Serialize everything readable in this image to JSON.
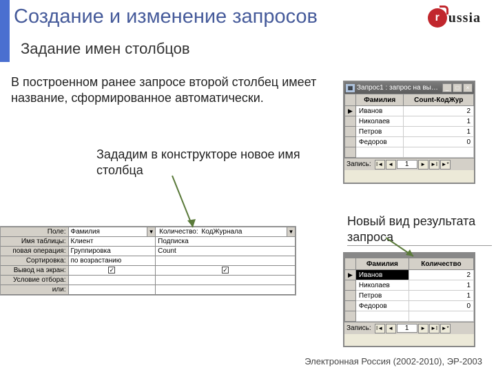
{
  "title": "Создание и изменение запросов",
  "subtitle": "Задание имен столбцов",
  "para1": "В построенном ранее запросе второй столбец имеет название, сформированное автоматически.",
  "para2": "Зададим в конструкторе новое имя столбца",
  "para3": "Новый вид результата запроса",
  "logo_text": "ussia",
  "logo_dot": "r",
  "footer": "Электронная Россия (2002-2010), ЭР-2003",
  "win1": {
    "title": "Запрос1 : запрос на вы…",
    "cols": [
      "Фамилия",
      "Count-КодЖур"
    ],
    "rows": [
      {
        "marker": "▶",
        "c0": "Иванов",
        "c1": "2"
      },
      {
        "marker": "",
        "c0": "Николаев",
        "c1": "1"
      },
      {
        "marker": "",
        "c0": "Петров",
        "c1": "1"
      },
      {
        "marker": "",
        "c0": "Федоров",
        "c1": "0"
      }
    ],
    "rec_label": "Запись:",
    "rec_pos": "1"
  },
  "win2": {
    "cols": [
      "Фамилия",
      "Количество"
    ],
    "rows": [
      {
        "marker": "▶",
        "c0": "Иванов",
        "c1": "2",
        "sel": true
      },
      {
        "marker": "",
        "c0": "Николаев",
        "c1": "1"
      },
      {
        "marker": "",
        "c0": "Петров",
        "c1": "1"
      },
      {
        "marker": "",
        "c0": "Федоров",
        "c1": "0"
      }
    ],
    "rec_label": "Запись:",
    "rec_pos": "1"
  },
  "qbe": {
    "labels": {
      "field": "Поле:",
      "table": "Имя таблицы:",
      "total": "повая операция:",
      "sort": "Сортировка:",
      "show": "Вывод на экран:",
      "criteria": "Условие отбора:",
      "or": "или:"
    },
    "col1": {
      "field": "Фамилия",
      "table": "Клиент",
      "total": "Группировка",
      "sort": "по возрастанию",
      "show": "✓"
    },
    "col2": {
      "field_label": "Количество:",
      "field_value": "КодЖурнала",
      "table": "Подписка",
      "total": "Count",
      "sort": "",
      "show": "✓"
    }
  },
  "navbtns": {
    "first": "I◄",
    "prev": "◄",
    "next": "►",
    "last": "►I",
    "new": "►*"
  }
}
